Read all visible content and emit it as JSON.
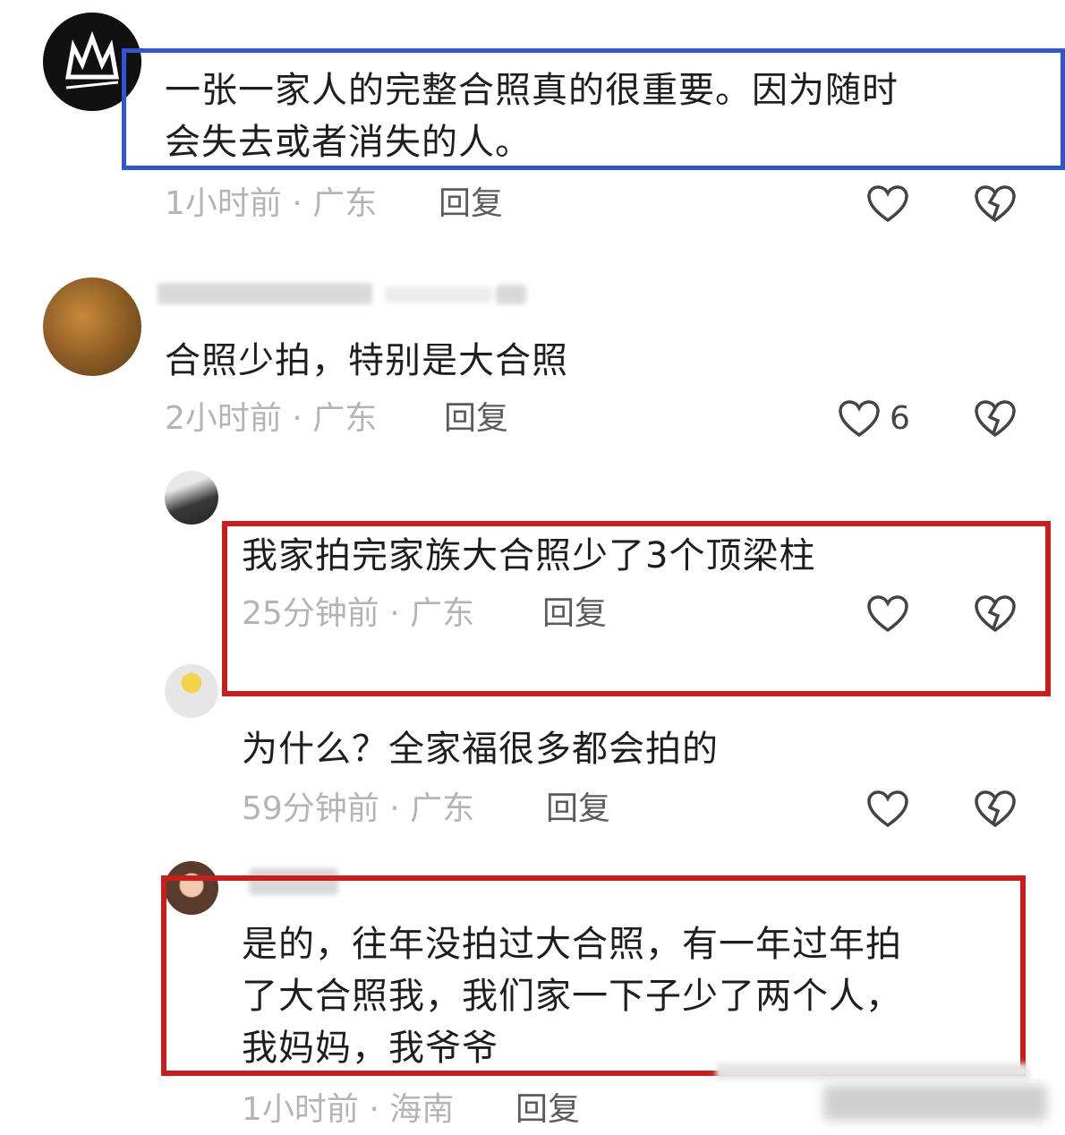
{
  "comments": [
    {
      "text_lines": [
        "一张一家人的完整合照真的很重要。因为随时",
        "会失去或者消失的人。"
      ],
      "time": "1小时前",
      "location": "广东",
      "reply": "回复",
      "likes": ""
    },
    {
      "text_lines": [
        "合照少拍，特别是大合照"
      ],
      "time": "2小时前",
      "location": "广东",
      "reply": "回复",
      "likes": "6"
    },
    {
      "text_lines": [
        "我家拍完家族大合照少了3个顶梁柱"
      ],
      "time": "25分钟前",
      "location": "广东",
      "reply": "回复",
      "likes": ""
    },
    {
      "text_lines": [
        "为什么？全家福很多都会拍的"
      ],
      "time": "59分钟前",
      "location": "广东",
      "reply": "回复",
      "likes": ""
    },
    {
      "text_lines": [
        "是的，往年没拍过大合照，有一年过年拍",
        "了大合照我，我们家一下子少了两个人，",
        "我妈妈，我爷爷"
      ],
      "time": "1小时前",
      "location": "海南",
      "reply": "回复",
      "likes": ""
    }
  ],
  "separator": " · ",
  "colors": {
    "highlight_blue": "#2f55d4",
    "highlight_red": "#c81e1e",
    "meta_gray": "#b4b4b4"
  }
}
